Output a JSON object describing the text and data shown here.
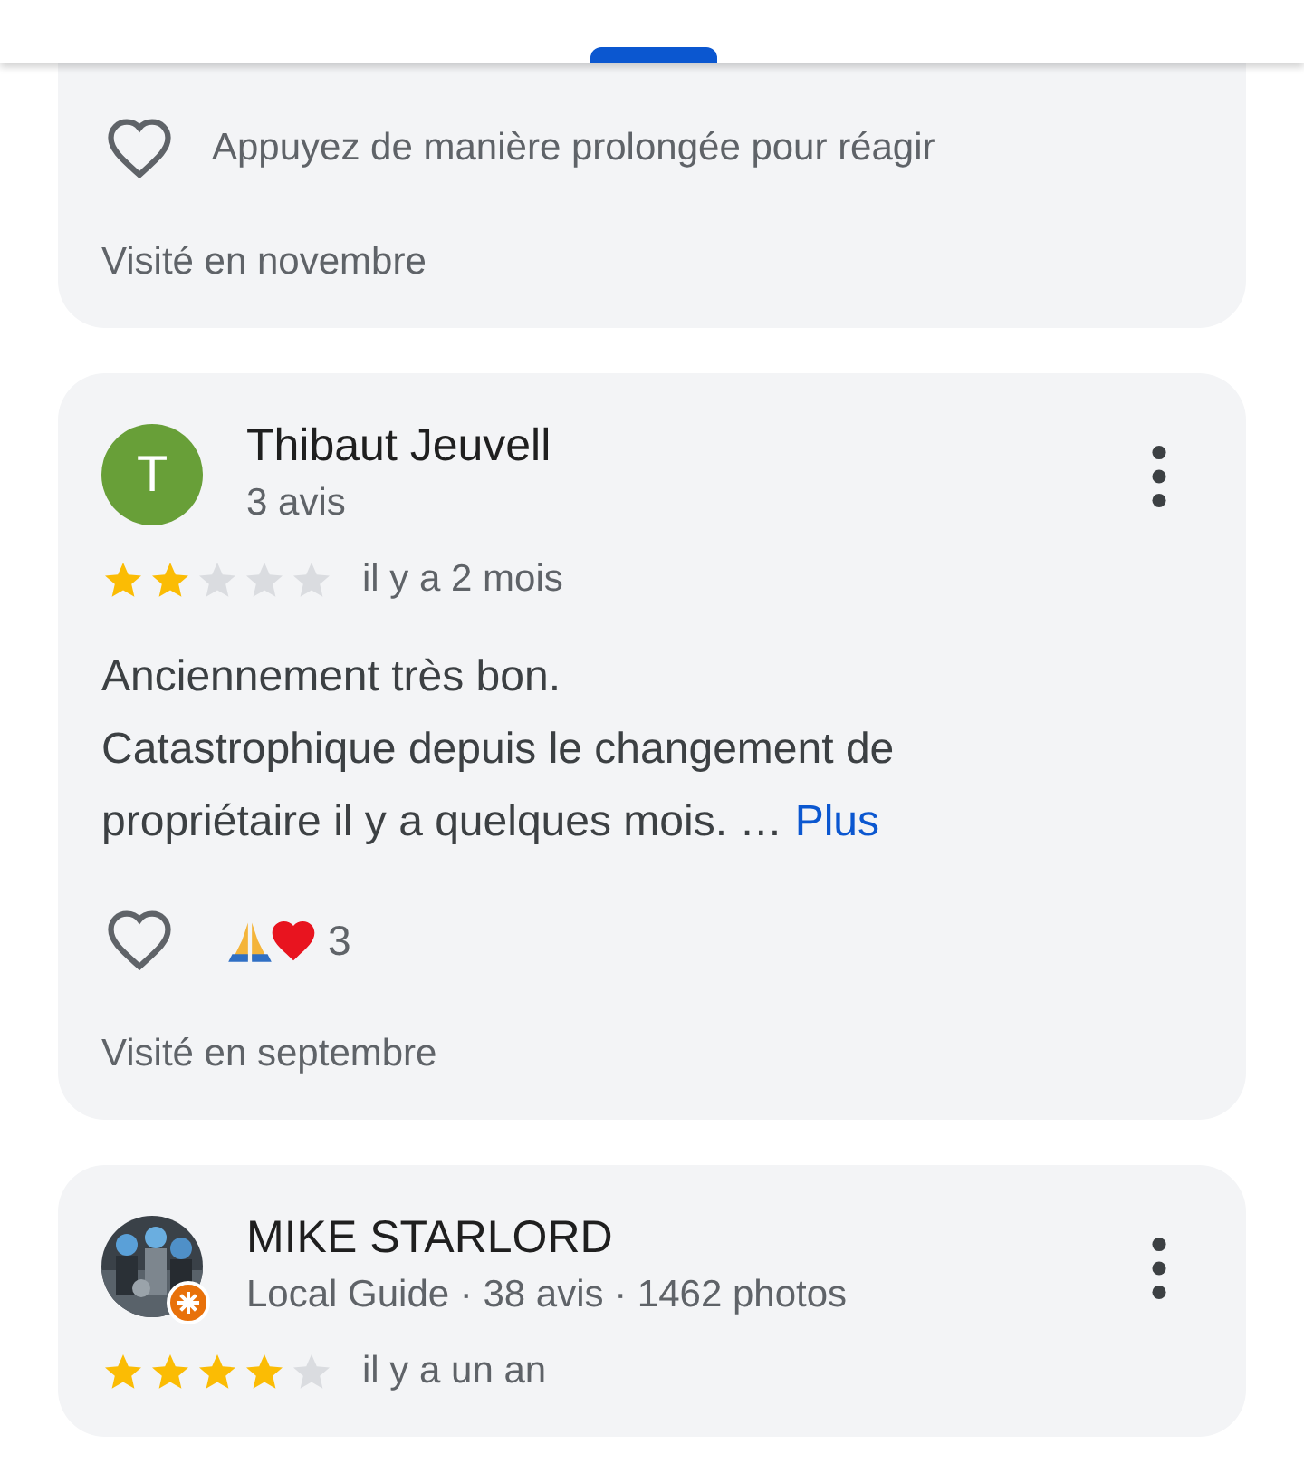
{
  "reviews": [
    {
      "kind": "partial",
      "react_prompt": "Appuyez de manière prolongée pour réagir",
      "visited": "Visité en novembre"
    },
    {
      "kind": "full",
      "author": "Thibaut Jeuvell",
      "avatar": {
        "kind": "initial",
        "letter": "T",
        "color": "#689f38"
      },
      "meta": "3 avis",
      "stars": 2,
      "date": "il y a 2 mois",
      "text": "Anciennement très bon.\nCatastrophique depuis le changement de propriétaire il y a quelques mois. …",
      "more": "Plus",
      "reactions": {
        "emojis": [
          {
            "kind": "pray"
          },
          {
            "kind": "heart"
          }
        ],
        "count": "3"
      },
      "visited": "Visité en septembre"
    },
    {
      "kind": "full",
      "author": "MIKE STARLORD",
      "avatar": {
        "kind": "picture",
        "local_guide": true
      },
      "meta": "Local Guide · 38 avis · 1462 photos",
      "stars": 4,
      "date": "il y a un an"
    }
  ]
}
